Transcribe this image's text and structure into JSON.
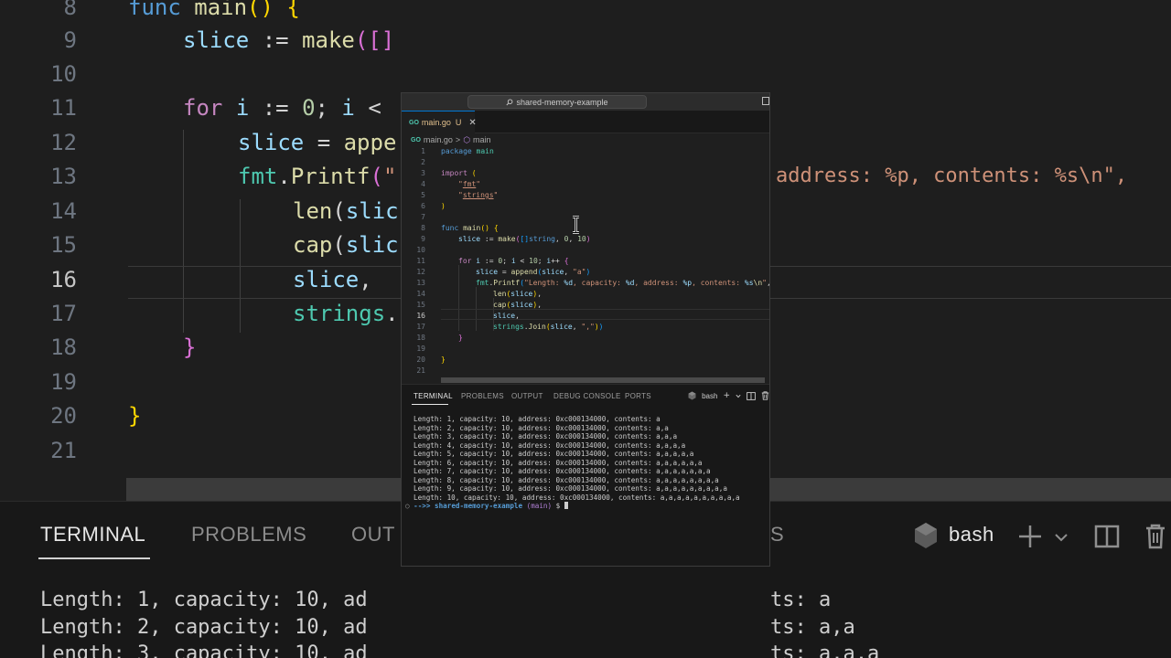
{
  "window": {
    "search_text": "shared-memory-example"
  },
  "tab": {
    "file_name": "main.go",
    "status": "U",
    "lang_badge": "GO"
  },
  "breadcrumb": {
    "file": "main.go",
    "separator": ">",
    "symbol": "main"
  },
  "editor": {
    "line_numbers": [
      "1",
      "2",
      "3",
      "4",
      "5",
      "6",
      "7",
      "8",
      "9",
      "10",
      "11",
      "12",
      "13",
      "14",
      "15",
      "16",
      "17",
      "18",
      "19",
      "20",
      "21"
    ],
    "active_line": "16"
  },
  "panel": {
    "tabs": [
      "TERMINAL",
      "PROBLEMS",
      "OUTPUT",
      "DEBUG CONSOLE",
      "PORTS"
    ],
    "shell": "bash"
  },
  "terminal": {
    "lines": [
      "Length: 1, capacity: 10, address: 0xc000134000, contents: a",
      "Length: 2, capacity: 10, address: 0xc000134000, contents: a,a",
      "Length: 3, capacity: 10, address: 0xc000134000, contents: a,a,a",
      "Length: 4, capacity: 10, address: 0xc000134000, contents: a,a,a,a",
      "Length: 5, capacity: 10, address: 0xc000134000, contents: a,a,a,a,a",
      "Length: 6, capacity: 10, address: 0xc000134000, contents: a,a,a,a,a,a",
      "Length: 7, capacity: 10, address: 0xc000134000, contents: a,a,a,a,a,a,a",
      "Length: 8, capacity: 10, address: 0xc000134000, contents: a,a,a,a,a,a,a,a",
      "Length: 9, capacity: 10, address: 0xc000134000, contents: a,a,a,a,a,a,a,a,a",
      "Length: 10, capacity: 10, address: 0xc000134000, contents: a,a,a,a,a,a,a,a,a,a"
    ],
    "prompt": {
      "dot": "○",
      "arrow": "-->>",
      "dir": "shared-memory-example",
      "branch": "(main)",
      "symbol": "$"
    }
  },
  "background": {
    "line_numbers": [
      "8",
      "9",
      "10",
      "11",
      "12",
      "13",
      "14",
      "15",
      "16",
      "17",
      "18",
      "19",
      "20",
      "21"
    ],
    "tabs": [
      "TERMINAL",
      "PROBLEMS",
      "OUT"
    ],
    "shell": "bash",
    "right_tab_fragment": "S",
    "right_fragment_13": "address: %p, contents: %s\\n\",",
    "terminal_lines": [
      "Length: 1, capacity: 10, ad",
      "Length: 2, capacity: 10, ad",
      "Length: 3, capacity: 10, ad"
    ],
    "terminal_right": [
      "ts: a",
      "ts: a,a",
      "ts: a,a,a"
    ]
  },
  "colors": {
    "accent": "#0078d4",
    "keyword": "#569cd6",
    "string": "#ce9178",
    "function": "#dcdcaa",
    "modified": "#e2c08d"
  }
}
